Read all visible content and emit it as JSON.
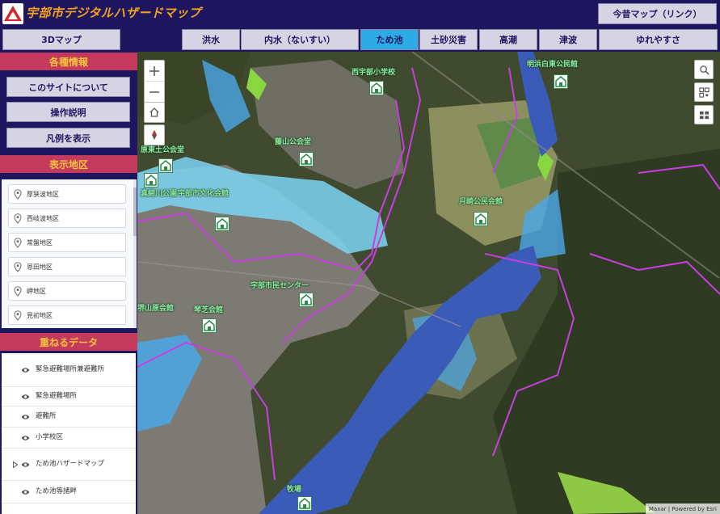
{
  "header": {
    "title": "宇部市デジタルハザードマップ",
    "ext_link": "今昔マップ（リンク）"
  },
  "tabs": [
    {
      "label": "3Dマップ"
    },
    {
      "label": "洪水"
    },
    {
      "label": "内水（ないすい）"
    },
    {
      "label": "ため池"
    },
    {
      "label": "土砂災害"
    },
    {
      "label": "高潮"
    },
    {
      "label": "津波"
    },
    {
      "label": "ゆれやすさ"
    }
  ],
  "active_tab": "ため池",
  "sidebar": {
    "info_heading": "各種情報",
    "about_button": "このサイトについて",
    "manual_button": "操作説明",
    "legend_button": "凡例を表示",
    "district_heading": "表示地区",
    "districts": [
      "厚狭波地区",
      "西岐波地区",
      "常盤地区",
      "恩田地区",
      "岬地区",
      "見初地区"
    ],
    "layers_heading": "重ねるデータ",
    "layers": [
      {
        "label": "緊急避難場所兼避難所",
        "expandable": false
      },
      {
        "label": "緊急避難場所",
        "expandable": false
      },
      {
        "label": "避難所",
        "expandable": false
      },
      {
        "label": "小学校区",
        "expandable": false
      },
      {
        "label": "ため池ハザードマップ",
        "expandable": true
      },
      {
        "label": "ため池等諸畔",
        "expandable": false
      }
    ]
  },
  "map": {
    "places": [
      "西宇部小学校",
      "藤山公会堂",
      "原東土公会堂",
      "明浜白東公民館",
      "月崎公民会館",
      "真締川公園",
      "宇部市文化会館",
      "琴芝会館",
      "宇部市民センター",
      "牧場",
      "堺山原会館"
    ],
    "attribution": "Maxar | Powered by Esri"
  },
  "colors": {
    "header_bg": "#1f1660",
    "title": "#f4a321",
    "section_heading_bg": "#c43a5c",
    "section_heading_text": "#f6c43b",
    "button_bg": "#d6d3e3",
    "active_tab": "#2dabe6",
    "flood_light": "#7cd3f2",
    "flood_mid": "#2f8fe0",
    "flood_deep": "#3a5bb8",
    "boundary": "#c83fe0"
  }
}
